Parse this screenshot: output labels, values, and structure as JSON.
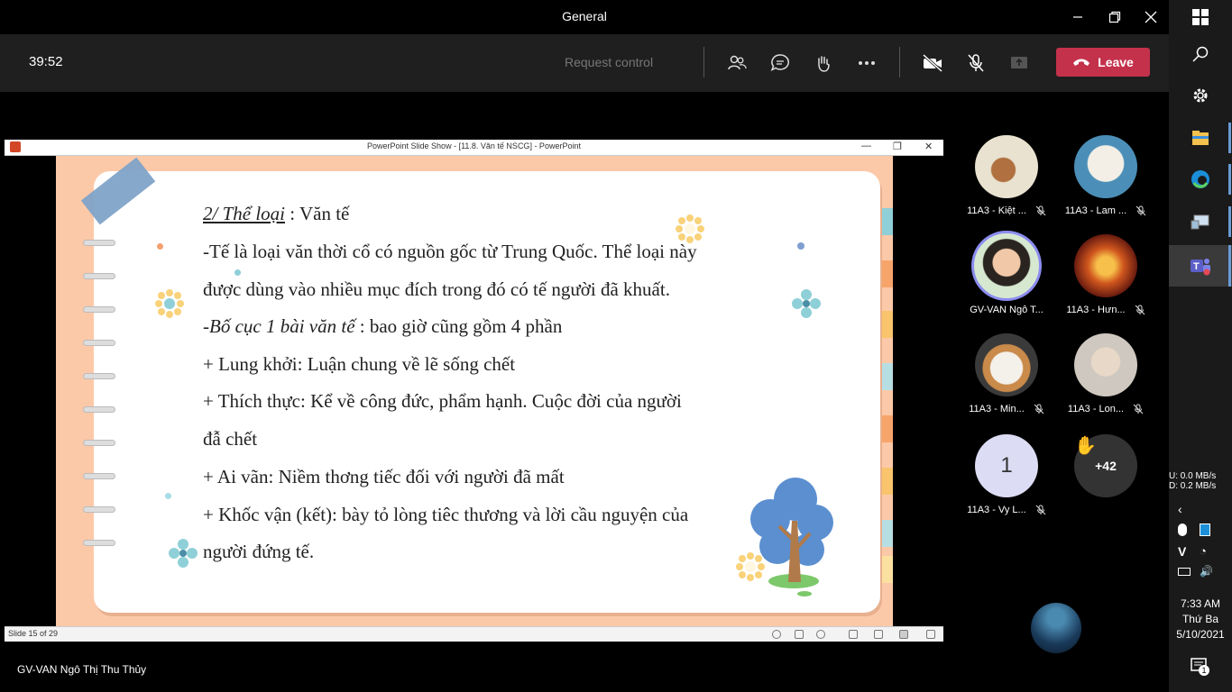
{
  "window": {
    "title": "General"
  },
  "toolbar": {
    "timer": "39:52",
    "request_control": "Request control",
    "leave_label": "Leave"
  },
  "ppt": {
    "title": "PowerPoint Slide Show - [11.8. Văn tế NSCG] - PowerPoint",
    "status": "Slide 15 of 29"
  },
  "slide": {
    "l1a": "2/ Thể loại",
    "l1b": " : Văn tế",
    "l2": "-Tế là loại văn thời cổ có nguồn gốc từ Trung Quốc. Thể loại này",
    "l3": "được dùng vào nhiều mục đích trong đó có tế người đã khuất.",
    "l4a": "-Bố cục 1 bài văn tế",
    "l4b": " : bao giờ cũng gồm 4 phần",
    "l5": "+ Lung khởi: Luận chung về lẽ sống chết",
    "l6": "+ Thích thực: Kể về công đức, phẩm hạnh. Cuộc đời của người",
    "l7": "đẫ chết",
    "l8": "+ Ai vãn: Niềm thơng tiếc đối với người đã mất",
    "l9": "+ Khốc vận (kết): bày tỏ lòng tiêc thương và lời cầu nguyện của",
    "l10": "người đứng tế."
  },
  "presenter": "GV-VAN Ngô Thị Thu Thủy",
  "participants": [
    {
      "name": "11A3 - Kiệt ..."
    },
    {
      "name": "11A3 - Lam ..."
    },
    {
      "name": "GV-VAN Ngô T..."
    },
    {
      "name": "11A3 - Hưn..."
    },
    {
      "name": "11A3 - Min..."
    },
    {
      "name": "11A3 - Lon..."
    },
    {
      "name": "11A3 - Vy L...",
      "initial": "1"
    },
    {
      "overflow": "+42"
    }
  ],
  "system": {
    "net_up": "U:     0.0 MB/s",
    "net_down": "D:     0.2 MB/s",
    "time": "7:33 AM",
    "day": "Thứ Ba",
    "date": "5/10/2021",
    "notif_count": "1"
  },
  "colors": {
    "leave": "#c4314b",
    "slide_bg": "#fcc9a8",
    "teams": "#5b5fc7"
  }
}
